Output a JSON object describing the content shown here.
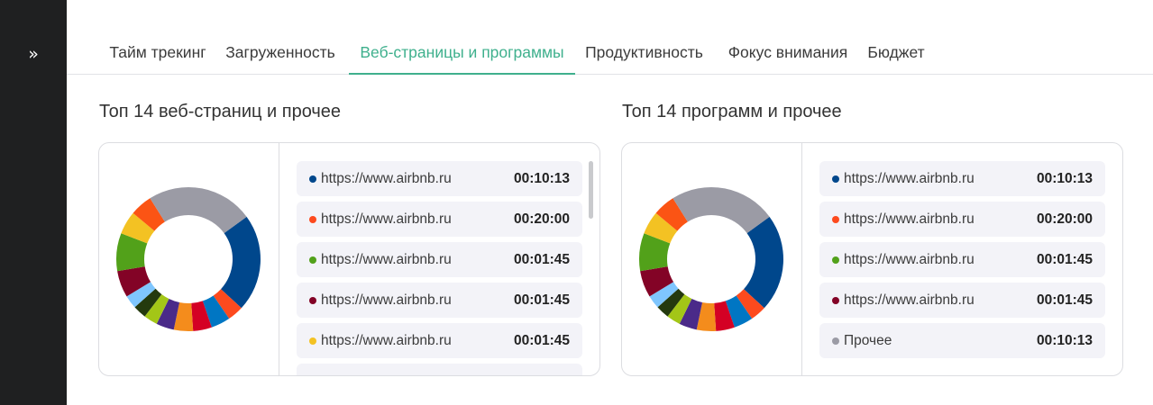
{
  "sidebar": {
    "toggle_icon": "chevrons-right-icon",
    "toggle_glyph": "»"
  },
  "tabs": [
    {
      "label": "Тайм трекинг",
      "active": false
    },
    {
      "label": "Загруженность",
      "active": false
    },
    {
      "label": "Веб-страницы и программы",
      "active": true
    },
    {
      "label": "Продуктивность",
      "active": false
    },
    {
      "label": "Фокус внимания",
      "active": false
    },
    {
      "label": "Бюджет",
      "active": false
    }
  ],
  "colors": {
    "accent": "#3fb08d",
    "slices": [
      "#00478c",
      "#fd4a1e",
      "#0076c3",
      "#d40024",
      "#f48c1c",
      "#4a2a89",
      "#a3c617",
      "#243a0e",
      "#7fc6fe",
      "#830326",
      "#52a11a",
      "#f3c223",
      "#fb5414",
      "#9b9ba5"
    ]
  },
  "web": {
    "title": "Топ 14 веб-страниц и прочее",
    "items": [
      {
        "label": "https://www.airbnb.ru",
        "time": "00:10:13",
        "color": "#00478c"
      },
      {
        "label": "https://www.airbnb.ru",
        "time": "00:20:00",
        "color": "#fd4a1e"
      },
      {
        "label": "https://www.airbnb.ru",
        "time": "00:01:45",
        "color": "#52a11a"
      },
      {
        "label": "https://www.airbnb.ru",
        "time": "00:01:45",
        "color": "#830326"
      },
      {
        "label": "https://www.airbnb.ru",
        "time": "00:01:45",
        "color": "#f3c223"
      }
    ]
  },
  "apps": {
    "title": "Топ 14 программ и прочее",
    "items": [
      {
        "label": "https://www.airbnb.ru",
        "time": "00:10:13",
        "color": "#00478c"
      },
      {
        "label": "https://www.airbnb.ru",
        "time": "00:20:00",
        "color": "#fd4a1e"
      },
      {
        "label": "https://www.airbnb.ru",
        "time": "00:01:45",
        "color": "#52a11a"
      },
      {
        "label": "https://www.airbnb.ru",
        "time": "00:01:45",
        "color": "#830326"
      },
      {
        "label": "Прочее",
        "time": "00:10:13",
        "color": "#9b9ba5"
      }
    ]
  },
  "chart_data": [
    {
      "type": "pie",
      "title": "Топ 14 веб-страниц и прочее",
      "values": [
        21.9,
        3.6,
        4.3,
        4.2,
        4.3,
        4.0,
        3.1,
        3.0,
        3.0,
        6.0,
        8.5,
        5.2,
        5.0,
        23.9
      ],
      "colors": [
        "#00478c",
        "#fd4a1e",
        "#0076c3",
        "#d40024",
        "#f48c1c",
        "#4a2a89",
        "#a3c617",
        "#243a0e",
        "#7fc6fe",
        "#830326",
        "#52a11a",
        "#f3c223",
        "#fb5414",
        "#9b9ba5"
      ]
    },
    {
      "type": "pie",
      "title": "Топ 14 программ и прочее",
      "values": [
        21.9,
        3.6,
        4.3,
        4.2,
        4.3,
        4.0,
        3.1,
        3.0,
        3.0,
        6.0,
        8.5,
        5.2,
        5.0,
        23.9
      ],
      "colors": [
        "#00478c",
        "#fd4a1e",
        "#0076c3",
        "#d40024",
        "#f48c1c",
        "#4a2a89",
        "#a3c617",
        "#243a0e",
        "#7fc6fe",
        "#830326",
        "#52a11a",
        "#f3c223",
        "#fb5414",
        "#9b9ba5"
      ]
    }
  ]
}
